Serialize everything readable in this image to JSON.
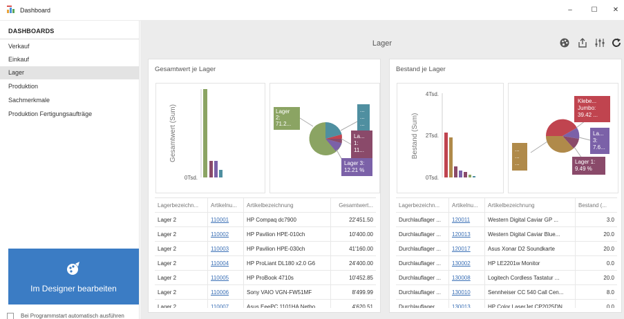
{
  "window": {
    "title": "Dashboard",
    "minimize": "–",
    "maximize": "☐",
    "close": "✕"
  },
  "sidebar": {
    "header": "DASHBOARDS",
    "items": [
      {
        "label": "Verkauf"
      },
      {
        "label": "Einkauf"
      },
      {
        "label": "Lager"
      },
      {
        "label": "Produktion"
      },
      {
        "label": "Sachmerkmale"
      },
      {
        "label": "Produktion Fertigungsaufträge"
      }
    ],
    "active_index": 2,
    "designer_label": "Im Designer bearbeiten",
    "autorun_label": "Bei Programmstart automatisch ausführen",
    "designer_color": "#3b7cc4"
  },
  "main": {
    "page_title": "Lager",
    "toolbar_icons": [
      "palette-icon",
      "export-icon",
      "filter-settings-icon",
      "refresh-icon"
    ]
  },
  "panels": [
    {
      "title": "Gesamtwert je Lager",
      "bar_chart": {
        "ylabel": "Gesamtwert (Sum)",
        "tick_labels": [
          "0Tsd."
        ]
      },
      "pie_labels": [
        {
          "text": [
            "Lager",
            "2:",
            "71.2..."
          ],
          "color": "#8ba463"
        },
        {
          "text": [
            "...",
            "...",
            "..."
          ],
          "color": "#4f8fa0"
        },
        {
          "text": [
            "La...",
            "1:",
            "11..."
          ],
          "color": "#8a4a6a"
        },
        {
          "text": [
            "Lager 3:",
            "12.21 %"
          ],
          "color": "#7b61a8"
        }
      ],
      "columns": [
        "Lagerbezeichn...",
        "Artikelnu...",
        "Artikelbezeichnung",
        "Gesamtwert..."
      ],
      "rows": [
        [
          "Lager 2",
          "110001",
          "HP Compaq dc7900",
          "22'451.50"
        ],
        [
          "Lager 2",
          "110002",
          "HP Pavilion HPE-010ch",
          "10'400.00"
        ],
        [
          "Lager 2",
          "110003",
          "HP Pavilion HPE-030ch",
          "41'160.00"
        ],
        [
          "Lager 2",
          "110004",
          "HP ProLiant DL180 x2.0 G6",
          "24'400.00"
        ],
        [
          "Lager 2",
          "110005",
          "HP ProBook 4710s",
          "10'452.85"
        ],
        [
          "Lager 2",
          "110006",
          "Sony VAIO VGN-FW51MF",
          "8'499.99"
        ],
        [
          "Lager 2",
          "110007",
          "Asus EeePC 1101HA Netbo...",
          "4'620.51"
        ]
      ]
    },
    {
      "title": "Bestand je Lager",
      "bar_chart": {
        "ylabel": "Bestand (Sum)",
        "tick_labels": [
          "4Tsd.",
          "2Tsd.",
          "0Tsd."
        ]
      },
      "pie_labels": [
        {
          "text": [
            "Klebe...",
            "Jumbo:",
            "39.42 ..."
          ],
          "color": "#c0444f"
        },
        {
          "text": [
            "La...",
            "3:",
            "7.6..."
          ],
          "color": "#7b61a8"
        },
        {
          "text": [
            "...",
            "...",
            "..."
          ],
          "color": "#b08a4a"
        },
        {
          "text": [
            "Lager 1:",
            "9.49 %"
          ],
          "color": "#8a4a6a"
        }
      ],
      "columns": [
        "Lagerbezeichn...",
        "Artikelnu...",
        "Artikelbezeichnung",
        "Bestand (..."
      ],
      "rows": [
        [
          "Durchlauflager ...",
          "120011",
          "Western Digital Caviar GP ...",
          "3.0"
        ],
        [
          "Durchlauflager ...",
          "120013",
          "Western Digital Caviar Blue...",
          "20.0"
        ],
        [
          "Durchlauflager ...",
          "120017",
          "Asus Xonar D2 Soundkarte",
          "20.0"
        ],
        [
          "Durchlauflager ...",
          "130002",
          "HP LE2201w Monitor",
          "0.0"
        ],
        [
          "Durchlauflager ...",
          "130008",
          "Logitech Cordless Tastatur ...",
          "20.0"
        ],
        [
          "Durchlauflager ...",
          "130010",
          "Sennheiser CC 540 Call Cen...",
          "8.0"
        ],
        [
          "Durchlauflager ...",
          "130013",
          "HP Color LaserJet CP2025DN",
          "0.0"
        ]
      ]
    }
  ]
}
